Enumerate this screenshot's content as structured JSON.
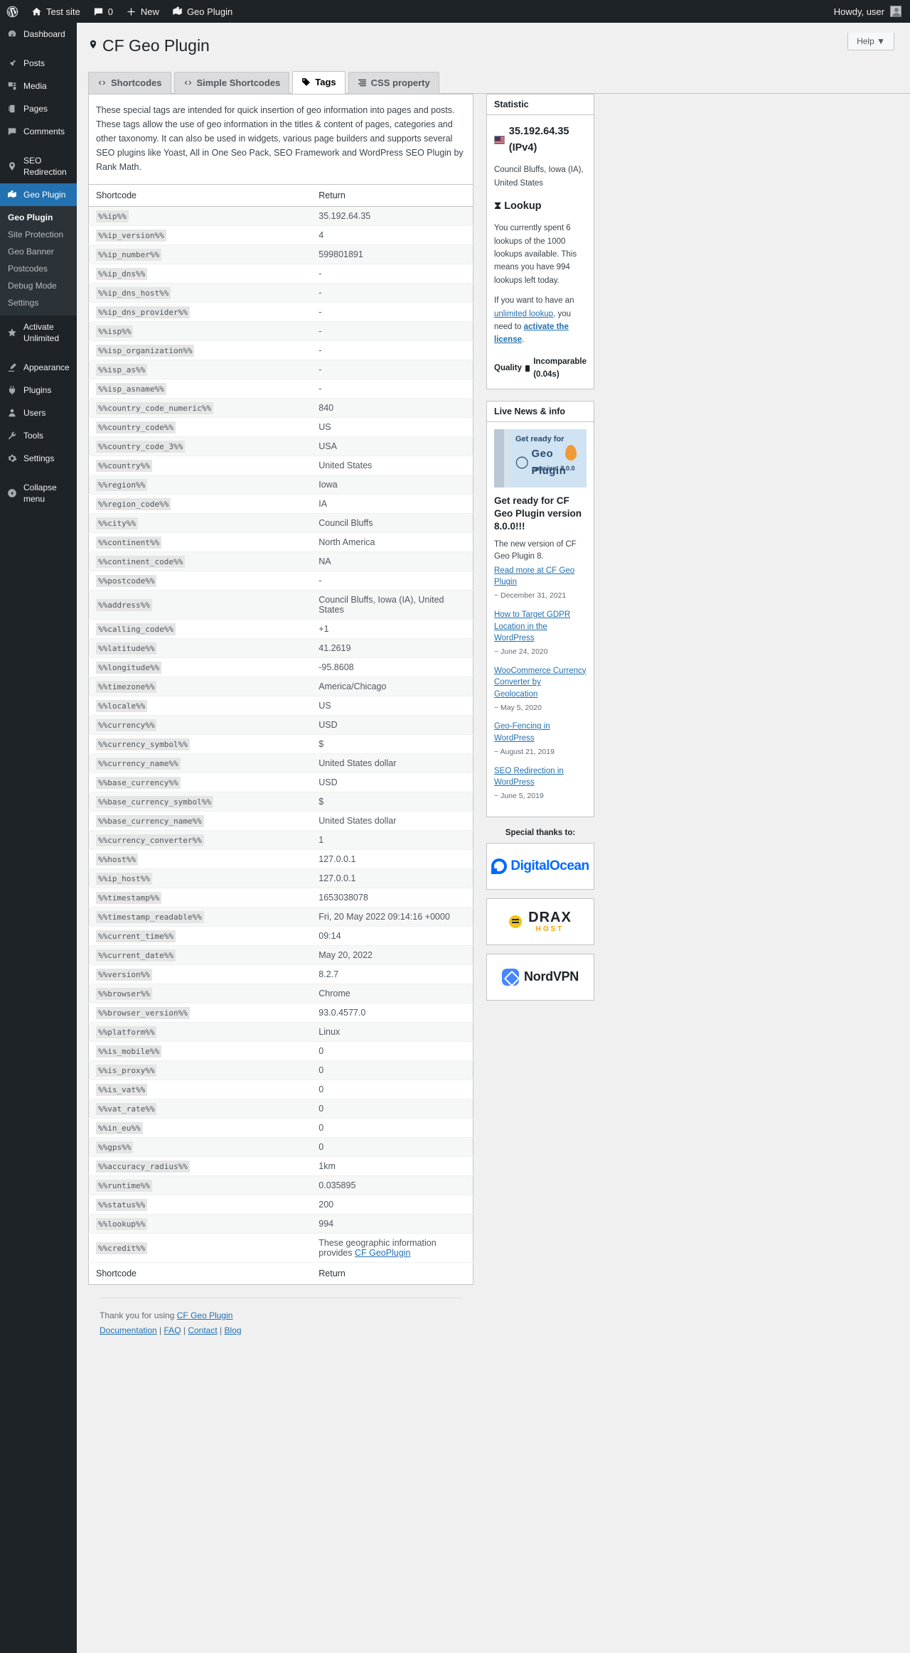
{
  "adminbar": {
    "logo_icon": "wordpress-logo-icon",
    "items": [
      {
        "label": "Test site",
        "icon": "home-icon"
      },
      {
        "label": "0",
        "icon": "comment-icon"
      },
      {
        "label": "New",
        "icon": "plus-icon"
      },
      {
        "label": "Geo Plugin",
        "icon": "map-marker-flag-icon"
      }
    ],
    "howdy": "Howdy, user"
  },
  "sidebar": {
    "items": [
      {
        "label": "Dashboard",
        "icon": "dashboard-icon",
        "current": false
      },
      {
        "label": "Posts",
        "icon": "pin-icon",
        "current": false
      },
      {
        "label": "Media",
        "icon": "media-icon",
        "current": false
      },
      {
        "label": "Pages",
        "icon": "pages-icon",
        "current": false
      },
      {
        "label": "Comments",
        "icon": "comments-icon",
        "current": false
      },
      {
        "label": "SEO Redirection",
        "icon": "marker-icon",
        "current": false
      },
      {
        "label": "Geo Plugin",
        "icon": "map-flag-icon",
        "current": true
      }
    ],
    "submenu": [
      {
        "label": "Geo Plugin",
        "current": true
      },
      {
        "label": "Site Protection",
        "current": false
      },
      {
        "label": "Geo Banner",
        "current": false
      },
      {
        "label": "Postcodes",
        "current": false
      },
      {
        "label": "Debug Mode",
        "current": false
      },
      {
        "label": "Settings",
        "current": false
      }
    ],
    "activate": {
      "label": "Activate Unlimited",
      "icon": "star-icon"
    },
    "bottom": [
      {
        "label": "Appearance",
        "icon": "appearance-icon"
      },
      {
        "label": "Plugins",
        "icon": "plugins-icon"
      },
      {
        "label": "Users",
        "icon": "users-icon"
      },
      {
        "label": "Tools",
        "icon": "tools-icon"
      },
      {
        "label": "Settings",
        "icon": "settings-icon"
      }
    ],
    "collapse": {
      "label": "Collapse menu",
      "icon": "collapse-icon"
    }
  },
  "header": {
    "help_label": "Help",
    "title": "CF Geo Plugin",
    "title_icon": "map-pin-icon"
  },
  "tabs": [
    {
      "label": "Shortcodes",
      "icon": "code-icon",
      "active": false
    },
    {
      "label": "Simple Shortcodes",
      "icon": "code-icon",
      "active": false
    },
    {
      "label": "Tags",
      "icon": "tag-icon",
      "active": true
    },
    {
      "label": "CSS property",
      "icon": "css-icon",
      "active": false
    }
  ],
  "intro": "These special tags are intended for quick insertion of geo information into pages and posts. These tags allow the use of geo information in the titles & content of pages, categories and other taxonomy. It can also be used in widgets, various page builders and supports several SEO plugins like Yoast, All in One Seo Pack, SEO Framework and WordPress SEO Plugin by Rank Math.",
  "table": {
    "columns": [
      "Shortcode",
      "Return"
    ],
    "rows": [
      {
        "shortcode": "%%ip%%",
        "return": "35.192.64.35"
      },
      {
        "shortcode": "%%ip_version%%",
        "return": "4"
      },
      {
        "shortcode": "%%ip_number%%",
        "return": "599801891"
      },
      {
        "shortcode": "%%ip_dns%%",
        "return": "-"
      },
      {
        "shortcode": "%%ip_dns_host%%",
        "return": "-"
      },
      {
        "shortcode": "%%ip_dns_provider%%",
        "return": "-"
      },
      {
        "shortcode": "%%isp%%",
        "return": "-"
      },
      {
        "shortcode": "%%isp_organization%%",
        "return": "-"
      },
      {
        "shortcode": "%%isp_as%%",
        "return": "-"
      },
      {
        "shortcode": "%%isp_asname%%",
        "return": "-"
      },
      {
        "shortcode": "%%country_code_numeric%%",
        "return": "840"
      },
      {
        "shortcode": "%%country_code%%",
        "return": "US"
      },
      {
        "shortcode": "%%country_code_3%%",
        "return": "USA"
      },
      {
        "shortcode": "%%country%%",
        "return": "United States"
      },
      {
        "shortcode": "%%region%%",
        "return": "Iowa"
      },
      {
        "shortcode": "%%region_code%%",
        "return": "IA"
      },
      {
        "shortcode": "%%city%%",
        "return": "Council Bluffs"
      },
      {
        "shortcode": "%%continent%%",
        "return": "North America"
      },
      {
        "shortcode": "%%continent_code%%",
        "return": "NA"
      },
      {
        "shortcode": "%%postcode%%",
        "return": "-"
      },
      {
        "shortcode": "%%address%%",
        "return": "Council Bluffs, Iowa (IA), United States"
      },
      {
        "shortcode": "%%calling_code%%",
        "return": "+1"
      },
      {
        "shortcode": "%%latitude%%",
        "return": "41.2619"
      },
      {
        "shortcode": "%%longitude%%",
        "return": "-95.8608"
      },
      {
        "shortcode": "%%timezone%%",
        "return": "America/Chicago"
      },
      {
        "shortcode": "%%locale%%",
        "return": "US"
      },
      {
        "shortcode": "%%currency%%",
        "return": "USD"
      },
      {
        "shortcode": "%%currency_symbol%%",
        "return": "$"
      },
      {
        "shortcode": "%%currency_name%%",
        "return": "United States dollar"
      },
      {
        "shortcode": "%%base_currency%%",
        "return": "USD"
      },
      {
        "shortcode": "%%base_currency_symbol%%",
        "return": "$"
      },
      {
        "shortcode": "%%base_currency_name%%",
        "return": "United States dollar"
      },
      {
        "shortcode": "%%currency_converter%%",
        "return": "1"
      },
      {
        "shortcode": "%%host%%",
        "return": "127.0.0.1"
      },
      {
        "shortcode": "%%ip_host%%",
        "return": "127.0.0.1"
      },
      {
        "shortcode": "%%timestamp%%",
        "return": "1653038078"
      },
      {
        "shortcode": "%%timestamp_readable%%",
        "return": "Fri, 20 May 2022 09:14:16 +0000"
      },
      {
        "shortcode": "%%current_time%%",
        "return": "09:14"
      },
      {
        "shortcode": "%%current_date%%",
        "return": "May 20, 2022"
      },
      {
        "shortcode": "%%version%%",
        "return": "8.2.7"
      },
      {
        "shortcode": "%%browser%%",
        "return": "Chrome"
      },
      {
        "shortcode": "%%browser_version%%",
        "return": "93.0.4577.0"
      },
      {
        "shortcode": "%%platform%%",
        "return": "Linux"
      },
      {
        "shortcode": "%%is_mobile%%",
        "return": "0"
      },
      {
        "shortcode": "%%is_proxy%%",
        "return": "0"
      },
      {
        "shortcode": "%%is_vat%%",
        "return": "0"
      },
      {
        "shortcode": "%%vat_rate%%",
        "return": "0"
      },
      {
        "shortcode": "%%in_eu%%",
        "return": "0"
      },
      {
        "shortcode": "%%gps%%",
        "return": "0"
      },
      {
        "shortcode": "%%accuracy_radius%%",
        "return": "1km"
      },
      {
        "shortcode": "%%runtime%%",
        "return": "0.035895"
      },
      {
        "shortcode": "%%status%%",
        "return": "200"
      },
      {
        "shortcode": "%%lookup%%",
        "return": "994"
      },
      {
        "shortcode": "%%credit%%",
        "return": "These geographic information provides ",
        "link": "CF GeoPlugin"
      }
    ]
  },
  "statistic": {
    "title": "Statistic",
    "flag_icon": "us-flag-icon",
    "ip": "35.192.64.35 (IPv4)",
    "location": "Council Bluffs, Iowa (IA), United States",
    "lookup_icon": "hourglass-icon",
    "lookup_title": "Lookup",
    "lookup_text": "You currently spent 6 lookups of the 1000 lookups available. This means you have 994 lookups left today.",
    "upsell_pre": "If you want to have an ",
    "upsell_link1": "unlimited lookup",
    "upsell_mid": ", you need to ",
    "upsell_link2": "activate the license",
    "upsell_post": ".",
    "quality_label": "Quality",
    "quality_icon": "signal-bar-icon",
    "quality_value": "Incomparable (0.04s)"
  },
  "news": {
    "title": "Live News & info",
    "banner": {
      "line1": "Get ready for",
      "line2": "Geo Plugin",
      "line3": "version: 8.0.0",
      "logo_icon": "wordpress-logo-icon"
    },
    "headline": "Get ready for CF Geo Plugin version 8.0.0!!!",
    "body": "The new version of CF Geo Plugin 8.",
    "body_link": "Read more at CF Geo Plugin",
    "body_date": "~ December 31, 2021",
    "items": [
      {
        "label": "How to Target GDPR Location in the WordPress",
        "date": "~ June 24, 2020"
      },
      {
        "label": "WooCommerce Currency Converter by Geolocation",
        "date": "~ May 5, 2020"
      },
      {
        "label": "Geo-Fencing in WordPress",
        "date": "~ August 21, 2019"
      },
      {
        "label": "SEO Redirection in WordPress",
        "date": "~ June 5, 2019"
      }
    ]
  },
  "thanks": {
    "title": "Special thanks to:",
    "sponsors": [
      {
        "name": "DigitalOcean",
        "icon": "digitalocean-logo-icon"
      },
      {
        "name": "DRAX",
        "sub": "HOST",
        "icon": "draxhost-logo-icon"
      },
      {
        "name": "NordVPN",
        "icon": "nordvpn-logo-icon"
      }
    ]
  },
  "footer": {
    "thanks_pre": "Thank you for using ",
    "thanks_link": "CF Geo Plugin",
    "links": [
      "Documentation",
      "FAQ",
      "Contact",
      "Blog"
    ],
    "separator": " | "
  }
}
